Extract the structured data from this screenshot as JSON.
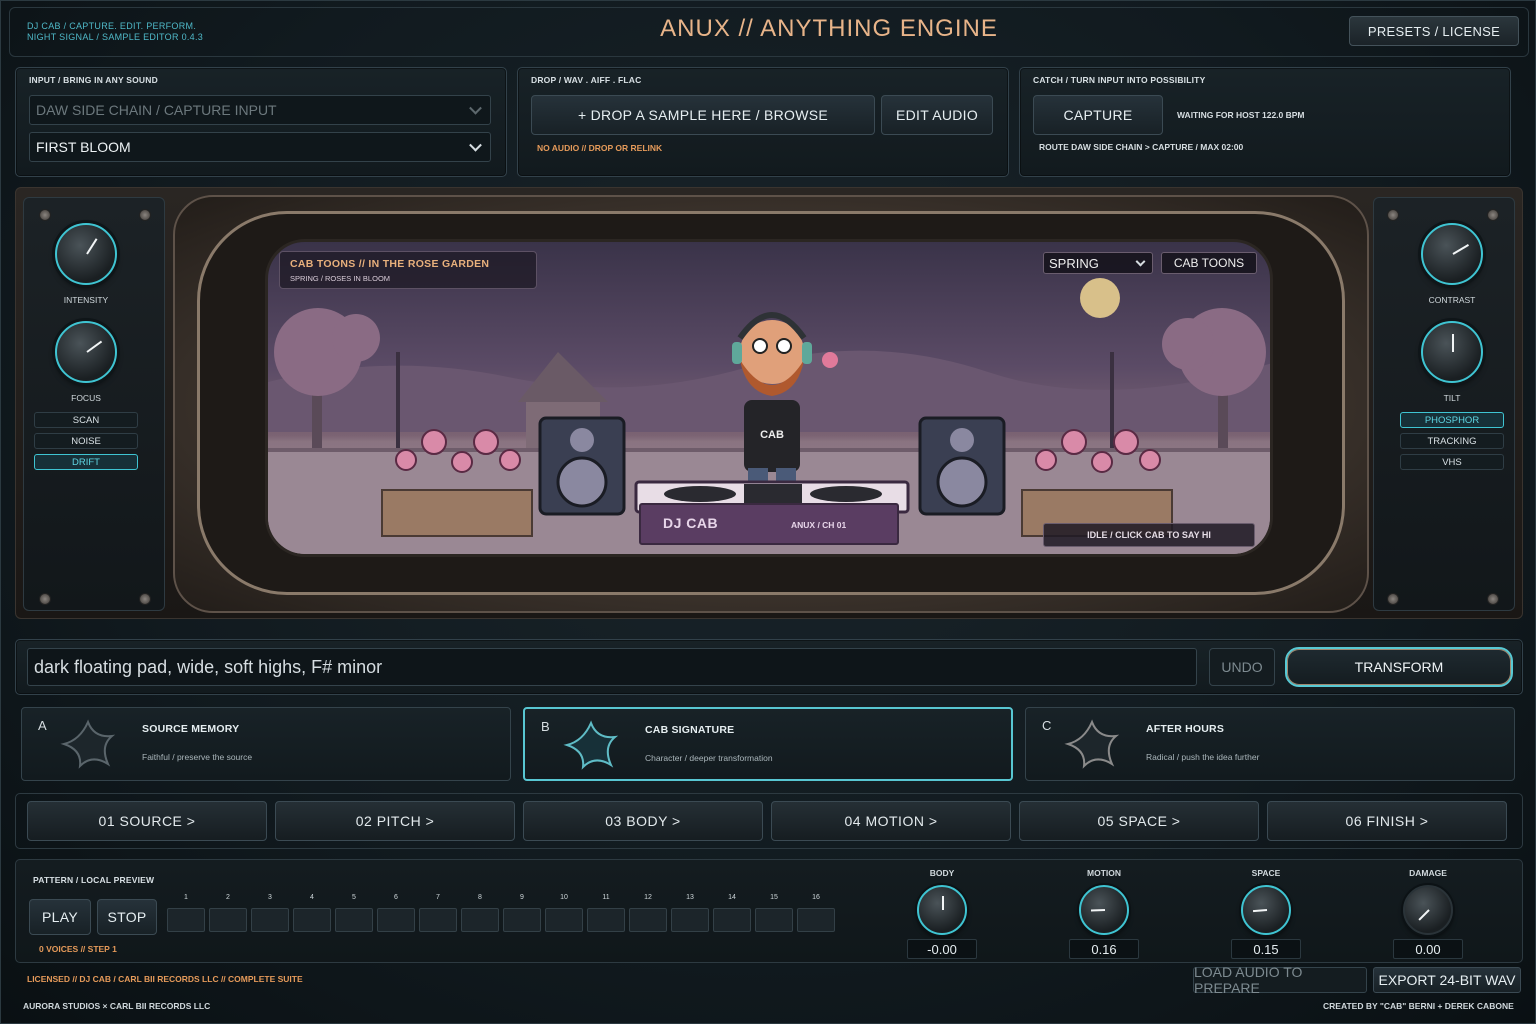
{
  "header": {
    "line1": "DJ CAB   /   CAPTURE. EDIT. PERFORM.",
    "line2": "NIGHT SIGNAL / SAMPLE EDITOR  0.4.3",
    "title": "ANUX  //  ANYTHING ENGINE",
    "presets_label": "PRESETS / LICENSE"
  },
  "input_panel": {
    "label": "INPUT / BRING IN ANY SOUND",
    "source_select": "DAW SIDE CHAIN / CAPTURE INPUT",
    "preset_select": "FIRST BLOOM"
  },
  "drop_panel": {
    "label": "DROP / WAV . AIFF . FLAC",
    "drop_label": "+   DROP A SAMPLE HERE   /   BROWSE",
    "edit_label": "EDIT AUDIO",
    "status": "NO AUDIO // DROP OR RELINK"
  },
  "catch_panel": {
    "label": "CATCH / TURN INPUT INTO POSSIBILITY",
    "capture_label": "CAPTURE",
    "waiting": "WAITING FOR HOST  122.0 BPM",
    "route": "ROUTE DAW SIDE CHAIN > CAPTURE / MAX 02:00"
  },
  "left_controls": {
    "intensity_label": "INTENSITY",
    "focus_label": "FOCUS",
    "intensity": 0.62,
    "focus": 0.7,
    "modes": [
      "SCAN",
      "NOISE",
      "DRIFT"
    ],
    "active_mode": "DRIFT"
  },
  "right_controls": {
    "contrast_label": "CONTRAST",
    "tilt_label": "TILT",
    "contrast": 0.72,
    "tilt": 0.5,
    "modes": [
      "PHOSPHOR",
      "TRACKING",
      "VHS"
    ],
    "active_mode": "PHOSPHOR"
  },
  "screen": {
    "scene_title": "CAB TOONS  //  IN THE ROSE GARDEN",
    "scene_sub": "SPRING / ROSES IN BLOOM",
    "season_select": "SPRING",
    "channel_button": "CAB TOONS",
    "shirt_text": "CAB",
    "dj_name": "DJ CAB",
    "dj_channel": "ANUX  /  CH 01",
    "status": "IDLE / CLICK CAB TO SAY HI",
    "colors": {
      "sky_top": "#3a3349",
      "sky_bottom": "#9b8896",
      "plate": "#5a3d62",
      "title_accent": "#e8b07c"
    }
  },
  "prompt": {
    "value": "dark floating pad, wide, soft highs, F# minor",
    "undo_label": "UNDO",
    "transform_label": "TRANSFORM"
  },
  "modes": [
    {
      "letter": "A",
      "title": "SOURCE MEMORY",
      "sub": "Faithful / preserve the source",
      "active": false
    },
    {
      "letter": "B",
      "title": "CAB SIGNATURE",
      "sub": "Character / deeper transformation",
      "active": true
    },
    {
      "letter": "C",
      "title": "AFTER HOURS",
      "sub": "Radical / push the idea further",
      "active": false
    }
  ],
  "stages": [
    "01   SOURCE   >",
    "02   PITCH   >",
    "03   BODY   >",
    "04   MOTION   >",
    "05   SPACE   >",
    "06   FINISH   >"
  ],
  "pattern": {
    "label": "PATTERN / LOCAL PREVIEW",
    "play_label": "PLAY",
    "stop_label": "STOP",
    "status": "0 VOICES // STEP 1",
    "steps": [
      "1",
      "2",
      "3",
      "4",
      "5",
      "6",
      "7",
      "8",
      "9",
      "10",
      "11",
      "12",
      "13",
      "14",
      "15",
      "16"
    ]
  },
  "macros": [
    {
      "label": "BODY",
      "value": "-0.00",
      "level": 0.0
    },
    {
      "label": "MOTION",
      "value": "0.16",
      "level": 0.16
    },
    {
      "label": "SPACE",
      "value": "0.15",
      "level": 0.15
    },
    {
      "label": "DAMAGE",
      "value": "0.00",
      "level": 0.0
    }
  ],
  "footer": {
    "license": "LICENSED // DJ CAB / CARL BII RECORDS LLC // COMPLETE SUITE",
    "load_label": "LOAD AUDIO TO PREPARE",
    "export_label": "EXPORT 24-BIT WAV",
    "left": "AURORA STUDIOS × CARL BII RECORDS LLC",
    "right": "CREATED BY \"CAB\" BERNI + DEREK CABONE"
  },
  "accent": "#3fc4d2"
}
